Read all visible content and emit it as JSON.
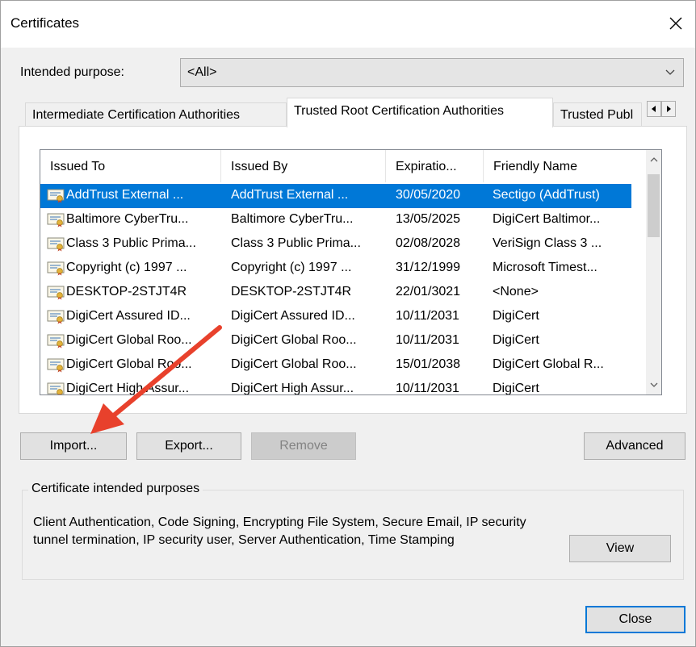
{
  "window": {
    "title": "Certificates"
  },
  "intended_purpose": {
    "label": "Intended purpose:",
    "value": "<All>"
  },
  "tabs": [
    {
      "label": "Intermediate Certification Authorities",
      "active": false
    },
    {
      "label": "Trusted Root Certification Authorities",
      "active": true
    },
    {
      "label": "Trusted Publ",
      "active": false
    }
  ],
  "list": {
    "columns": [
      "Issued To",
      "Issued By",
      "Expiratio...",
      "Friendly Name"
    ],
    "rows": [
      {
        "issued_to": "AddTrust External ...",
        "issued_by": "AddTrust External ...",
        "expiration": "30/05/2020",
        "friendly": "Sectigo (AddTrust)",
        "selected": true
      },
      {
        "issued_to": "Baltimore CyberTru...",
        "issued_by": "Baltimore CyberTru...",
        "expiration": "13/05/2025",
        "friendly": "DigiCert Baltimor...",
        "selected": false
      },
      {
        "issued_to": "Class 3 Public Prima...",
        "issued_by": "Class 3 Public Prima...",
        "expiration": "02/08/2028",
        "friendly": "VeriSign Class 3 ...",
        "selected": false
      },
      {
        "issued_to": "Copyright (c) 1997 ...",
        "issued_by": "Copyright (c) 1997 ...",
        "expiration": "31/12/1999",
        "friendly": "Microsoft Timest...",
        "selected": false
      },
      {
        "issued_to": "DESKTOP-2STJT4R",
        "issued_by": "DESKTOP-2STJT4R",
        "expiration": "22/01/3021",
        "friendly": "<None>",
        "selected": false
      },
      {
        "issued_to": "DigiCert Assured ID...",
        "issued_by": "DigiCert Assured ID...",
        "expiration": "10/11/2031",
        "friendly": "DigiCert",
        "selected": false
      },
      {
        "issued_to": "DigiCert Global Roo...",
        "issued_by": "DigiCert Global Roo...",
        "expiration": "10/11/2031",
        "friendly": "DigiCert",
        "selected": false
      },
      {
        "issued_to": "DigiCert Global Roo...",
        "issued_by": "DigiCert Global Roo...",
        "expiration": "15/01/2038",
        "friendly": "DigiCert Global R...",
        "selected": false
      },
      {
        "issued_to": "DigiCert High Assur...",
        "issued_by": "DigiCert High Assur...",
        "expiration": "10/11/2031",
        "friendly": "DigiCert",
        "selected": false
      }
    ]
  },
  "buttons": {
    "import": "Import...",
    "export": "Export...",
    "remove": "Remove",
    "advanced": "Advanced",
    "view": "View",
    "close": "Close"
  },
  "purposes_group": {
    "legend": "Certificate intended purposes",
    "text": "Client Authentication, Code Signing, Encrypting File System, Secure Email, IP security tunnel termination, IP security user, Server Authentication, Time Stamping"
  },
  "colors": {
    "selection": "#0078d7",
    "annotation_arrow": "#e8412c"
  },
  "icons": {
    "close": "close-icon",
    "dropdown": "chevron-down-icon",
    "certificate": "certificate-icon"
  }
}
